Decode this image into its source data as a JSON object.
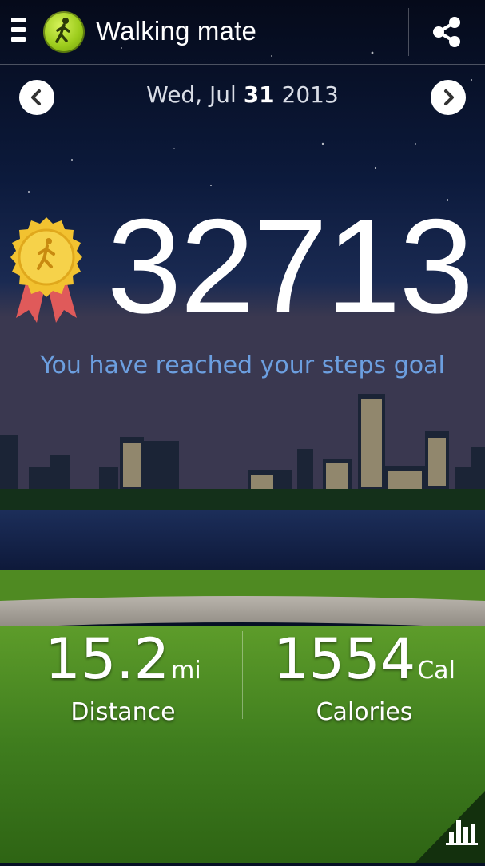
{
  "header": {
    "title": "Walking mate"
  },
  "date": {
    "weekday_month": "Wed, Jul ",
    "day": "31",
    "year": " 2013"
  },
  "steps": {
    "count": "32713",
    "goal_message": "You have reached your steps goal"
  },
  "stats": {
    "distance": {
      "value": "15.2",
      "unit": "mi",
      "label": "Distance"
    },
    "calories": {
      "value": "1554",
      "unit": "Cal",
      "label": "Calories"
    }
  },
  "icons": {
    "menu": "menu-icon",
    "app": "walking-person-icon",
    "share": "share-icon",
    "prev": "chevron-left-icon",
    "next": "chevron-right-icon",
    "medal": "award-medal-icon",
    "chart": "bar-chart-icon"
  },
  "colors": {
    "goal_text": "#6c9fe0",
    "app_icon": "#9ccc1c",
    "award_gold": "#f2c230",
    "ribbon": "#e05a5a"
  }
}
